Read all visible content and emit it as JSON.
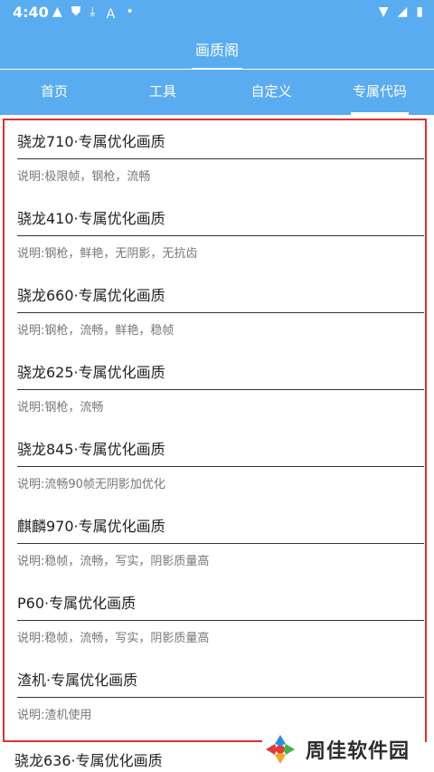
{
  "status": {
    "time": "4:40",
    "left_icons": [
      "warning-icon",
      "shield-icon",
      "download-icon",
      "font-icon",
      "dot-icon"
    ],
    "right_icons": [
      "wifi-icon",
      "signal-icon",
      "battery-icon"
    ]
  },
  "appbar": {
    "title": "画质阁"
  },
  "tabs": [
    {
      "label": "首页",
      "active": false
    },
    {
      "label": "工具",
      "active": false
    },
    {
      "label": "自定义",
      "active": false
    },
    {
      "label": "专属代码",
      "active": true
    }
  ],
  "items": [
    {
      "title": "骁龙710·专属优化画质",
      "desc": "说明:极限帧，钢枪，流畅"
    },
    {
      "title": "骁龙410·专属优化画质",
      "desc": "说明:钢枪，鲜艳，无阴影，无抗齿"
    },
    {
      "title": "骁龙660·专属优化画质",
      "desc": "说明:钢枪，流畅，鲜艳，稳帧"
    },
    {
      "title": "骁龙625·专属优化画质",
      "desc": "说明:钢枪，流畅"
    },
    {
      "title": "骁龙845·专属优化画质",
      "desc": "说明:流畅90帧无阴影加优化"
    },
    {
      "title": "麒麟970·专属优化画质",
      "desc": "说明:稳帧，流畅，写实，阴影质量高"
    },
    {
      "title": "P60·专属优化画质",
      "desc": "说明:稳帧，流畅，写实，阴影质量高"
    },
    {
      "title": "渣机·专属优化画质",
      "desc": "说明:渣机使用"
    }
  ],
  "extra_item": {
    "title": "骁龙636·专属优化画质"
  },
  "watermark": {
    "text": "周佳软件园"
  },
  "colors": {
    "primary": "#5aacf0",
    "highlight_border": "#e03030"
  }
}
